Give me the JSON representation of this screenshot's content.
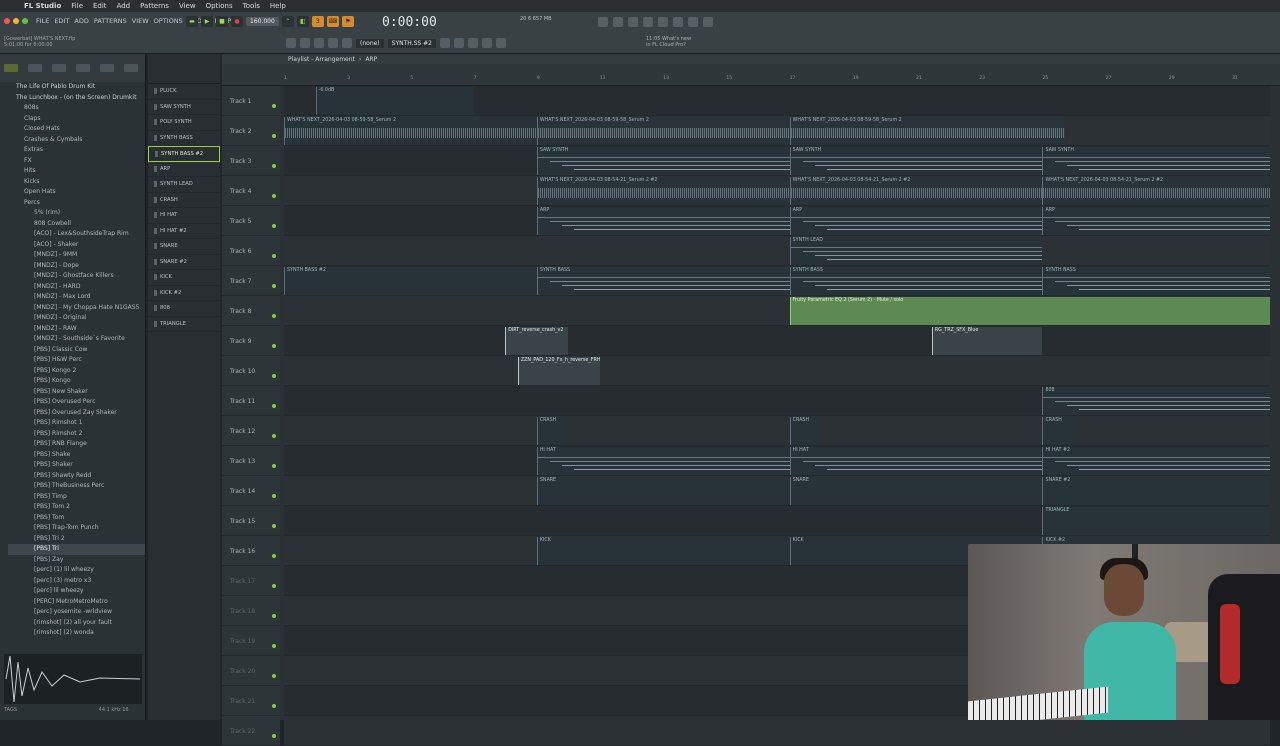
{
  "mac_menu": [
    "FL Studio",
    "File",
    "Edit",
    "Add",
    "Patterns",
    "View",
    "Options",
    "Tools",
    "Help"
  ],
  "fl_menu": [
    "FILE",
    "EDIT",
    "ADD",
    "PATTERNS",
    "VIEW",
    "OPTIONS",
    "TOOLS",
    "HELP"
  ],
  "project": {
    "title": "WHAT'S NEXT.flp",
    "line1": "[Gowerbat]  WHAT'S NEXT.flp",
    "line2": "5:01:00 for 8:00:00"
  },
  "transport": {
    "tempo": "160.000",
    "time": "0:00:00",
    "cpu": "20  6  657 MB",
    "pattern_mode": "(none)",
    "pattern": "SYNTH.SS #2"
  },
  "news": {
    "line1": "11:05  What's new",
    "line2": "in FL Cloud Pro?"
  },
  "browser": {
    "items": [
      {
        "label": "The Life Of Pablo Drum Kit",
        "level": "l1"
      },
      {
        "label": "The Lunchbox - (on the Screen) Drumkit",
        "level": "l1"
      },
      {
        "label": "808s",
        "level": "l2"
      },
      {
        "label": "Claps",
        "level": "l2"
      },
      {
        "label": "Closed Hats",
        "level": "l2"
      },
      {
        "label": "Crashes & Cymbals",
        "level": "l2"
      },
      {
        "label": "Extras",
        "level": "l2"
      },
      {
        "label": "FX",
        "level": "l2"
      },
      {
        "label": "Hits",
        "level": "l2"
      },
      {
        "label": "Kicks",
        "level": "l2"
      },
      {
        "label": "Open Hats",
        "level": "l2"
      },
      {
        "label": "Percs",
        "level": "l2"
      },
      {
        "label": "5% (rim)",
        "level": "l3"
      },
      {
        "label": "808 Cowbell",
        "level": "l3"
      },
      {
        "label": "[ACO] - Lex&SouthsideTrap Rim",
        "level": "l3"
      },
      {
        "label": "[ACO] - Shaker",
        "level": "l3"
      },
      {
        "label": "[MNDZ] - 9MM",
        "level": "l3"
      },
      {
        "label": "[MNDZ] - Dope",
        "level": "l3"
      },
      {
        "label": "[MNDZ] - Ghostface Killers",
        "level": "l3"
      },
      {
        "label": "[MNDZ] - HARD",
        "level": "l3"
      },
      {
        "label": "[MNDZ] - Max Lord",
        "level": "l3"
      },
      {
        "label": "[MNDZ] - My Choppa Hate N1GAS5",
        "level": "l3"
      },
      {
        "label": "[MNDZ] - Original",
        "level": "l3"
      },
      {
        "label": "[MNDZ] - RAW",
        "level": "l3"
      },
      {
        "label": "[MNDZ] - Southside`s Favorite",
        "level": "l3"
      },
      {
        "label": "[PBS] Classic Cow",
        "level": "l3"
      },
      {
        "label": "[PBS] H&W Perc",
        "level": "l3"
      },
      {
        "label": "[PBS] Kongo 2",
        "level": "l3"
      },
      {
        "label": "[PBS] Kongo",
        "level": "l3"
      },
      {
        "label": "[PBS] New Shaker",
        "level": "l3"
      },
      {
        "label": "[PBS] Overused Perc",
        "level": "l3"
      },
      {
        "label": "[PBS] Overused Zay Shaker",
        "level": "l3"
      },
      {
        "label": "[PBS] Rimshot 1",
        "level": "l3"
      },
      {
        "label": "[PBS] Rimshot 2",
        "level": "l3"
      },
      {
        "label": "[PBS] RNB Flange",
        "level": "l3"
      },
      {
        "label": "[PBS] Shake",
        "level": "l3"
      },
      {
        "label": "[PBS] Shaker",
        "level": "l3"
      },
      {
        "label": "[PBS] Shawty Redd",
        "level": "l3"
      },
      {
        "label": "[PBS] TheBusiness Perc",
        "level": "l3"
      },
      {
        "label": "[PBS] Timp",
        "level": "l3"
      },
      {
        "label": "[PBS] Tom 2",
        "level": "l3"
      },
      {
        "label": "[PBS] Tom",
        "level": "l3"
      },
      {
        "label": "[PBS] Trap-Tom Punch",
        "level": "l3"
      },
      {
        "label": "[PBS] Tri 2",
        "level": "l3"
      },
      {
        "label": "[PBS] Tri",
        "level": "l3 act"
      },
      {
        "label": "[PBS] Zay",
        "level": "l3"
      },
      {
        "label": "[perc] (1) lil wheezy",
        "level": "l3"
      },
      {
        "label": "[perc] (3) metro x3",
        "level": "l3"
      },
      {
        "label": "[perc] lil wheezy",
        "level": "l3"
      },
      {
        "label": "[PERC] MetroMetroMetro",
        "level": "l3"
      },
      {
        "label": "[perc] yosemite -wrldview",
        "level": "l3"
      },
      {
        "label": "[rimshot] (2) all your fault",
        "level": "l3"
      },
      {
        "label": "[rimshot] (2) wonda",
        "level": "l3"
      }
    ],
    "preview_info": "44.1 kHz 16",
    "footer": "TAGS"
  },
  "picker": [
    "PLUCK",
    "SAW SYNTH",
    "POLY SYNTH",
    "SYNTH BASS",
    "SYNTH BASS #2",
    "ARP",
    "SYNTH LEAD",
    "CRASH",
    "HI HAT",
    "HI HAT #2",
    "SNARE",
    "SNARE #2",
    "KICK",
    "KICK #2",
    "808",
    "TRIANGLE"
  ],
  "picker_selected": 4,
  "playlist": {
    "title": "Playlist - Arrangement",
    "current": "ARP",
    "ruler": [
      "1",
      "3",
      "5",
      "7",
      "9",
      "11",
      "13",
      "15",
      "17",
      "19",
      "21",
      "23",
      "25",
      "27",
      "29",
      "31"
    ],
    "tracks": [
      "Track 1",
      "Track 2",
      "Track 3",
      "Track 4",
      "Track 5",
      "Track 6",
      "Track 7",
      "Track 8",
      "Track 9",
      "Track 10",
      "Track 11",
      "Track 12",
      "Track 13",
      "Track 14",
      "Track 15",
      "Track 16",
      "Track 17",
      "Track 18",
      "Track 19",
      "Track 20",
      "Track 21",
      "Track 22"
    ],
    "clips": [
      {
        "track": 0,
        "start": 1,
        "end": 6,
        "label": "-6.0dB",
        "kind": "dark"
      },
      {
        "track": 1,
        "start": 0,
        "end": 24.7,
        "label": "WHAT'S NEXT_2026-04-03 08-59-58_Serum 2",
        "kind": "wave"
      },
      {
        "track": 1,
        "start": 8,
        "end": 24.7,
        "label": "WHAT'S NEXT_2026-04-03 08-59-58_Serum 2",
        "kind": "wave"
      },
      {
        "track": 1,
        "start": 16,
        "end": 24.7,
        "label": "WHAT'S NEXT_2026-04-03 08-59-58_Serum 2",
        "kind": "wave"
      },
      {
        "track": 2,
        "start": 8,
        "end": 16,
        "label": "SAW SYNTH",
        "kind": "notes"
      },
      {
        "track": 2,
        "start": 16,
        "end": 24,
        "label": "SAW SYNTH",
        "kind": "notes"
      },
      {
        "track": 2,
        "start": 24,
        "end": 31.2,
        "label": "SAW SYNTH",
        "kind": "notes"
      },
      {
        "track": 3,
        "start": 8,
        "end": 16,
        "label": "WHAT'S NEXT_2026-04-03 08-54-21_Serum 2 #2",
        "kind": "wave"
      },
      {
        "track": 3,
        "start": 16,
        "end": 24,
        "label": "WHAT'S NEXT_2026-04-03 08-54-21_Serum 2 #2",
        "kind": "wave"
      },
      {
        "track": 3,
        "start": 24,
        "end": 31.2,
        "label": "WHAT'S NEXT_2026-04-03 08-54-21_Serum 2 #2",
        "kind": "wave"
      },
      {
        "track": 4,
        "start": 8,
        "end": 16,
        "label": "ARP",
        "kind": "notes"
      },
      {
        "track": 4,
        "start": 16,
        "end": 24,
        "label": "ARP",
        "kind": "notes"
      },
      {
        "track": 4,
        "start": 24,
        "end": 31.2,
        "label": "ARP",
        "kind": "notes"
      },
      {
        "track": 5,
        "start": 16,
        "end": 24,
        "label": "SYNTH LEAD",
        "kind": "notes"
      },
      {
        "track": 6,
        "start": 0,
        "end": 8,
        "label": "SYNTH BASS #2",
        "kind": "dark"
      },
      {
        "track": 6,
        "start": 8,
        "end": 16,
        "label": "SYNTH BASS",
        "kind": "notes"
      },
      {
        "track": 6,
        "start": 16,
        "end": 24,
        "label": "SYNTH BASS",
        "kind": "notes"
      },
      {
        "track": 6,
        "start": 24,
        "end": 31.2,
        "label": "SYNTH BASS",
        "kind": "notes"
      },
      {
        "track": 7,
        "start": 16,
        "end": 31.2,
        "label": "Fruity Parametric EQ 2 (Serum 2) - Mute / solo",
        "kind": "green"
      },
      {
        "track": 8,
        "start": 7,
        "end": 9,
        "label": "DIRT_reverse_crash_v2",
        "kind": "white"
      },
      {
        "track": 8,
        "start": 20.5,
        "end": 24,
        "label": "RG_TRZ_SFX_Blue",
        "kind": "white"
      },
      {
        "track": 9,
        "start": 7.4,
        "end": 10,
        "label": "ZZN_PAD_120_Fx_h_reverse_FRH",
        "kind": "white"
      },
      {
        "track": 10,
        "start": 24,
        "end": 31.2,
        "label": "808",
        "kind": "notes"
      },
      {
        "track": 11,
        "start": 8,
        "end": 9,
        "label": "CRASH",
        "kind": "dark"
      },
      {
        "track": 11,
        "start": 16,
        "end": 17,
        "label": "CRASH",
        "kind": "dark"
      },
      {
        "track": 11,
        "start": 24,
        "end": 25,
        "label": "CRASH",
        "kind": "dark"
      },
      {
        "track": 12,
        "start": 8,
        "end": 16,
        "label": "HI HAT",
        "kind": "notes"
      },
      {
        "track": 12,
        "start": 16,
        "end": 24,
        "label": "HI HAT",
        "kind": "notes"
      },
      {
        "track": 12,
        "start": 24,
        "end": 31.2,
        "label": "HI HAT #2",
        "kind": "notes"
      },
      {
        "track": 13,
        "start": 8,
        "end": 16,
        "label": "SNARE",
        "kind": "dark"
      },
      {
        "track": 13,
        "start": 16,
        "end": 24,
        "label": "SNARE",
        "kind": "dark"
      },
      {
        "track": 13,
        "start": 24,
        "end": 31.2,
        "label": "SNARE #2",
        "kind": "dark"
      },
      {
        "track": 14,
        "start": 24,
        "end": 31.2,
        "label": "TRIANGLE",
        "kind": "dark"
      },
      {
        "track": 15,
        "start": 8,
        "end": 16,
        "label": "KICK",
        "kind": "dark"
      },
      {
        "track": 15,
        "start": 16,
        "end": 24,
        "label": "KICK",
        "kind": "dark"
      },
      {
        "track": 15,
        "start": 24,
        "end": 31.2,
        "label": "KICK #2",
        "kind": "dark"
      }
    ]
  }
}
